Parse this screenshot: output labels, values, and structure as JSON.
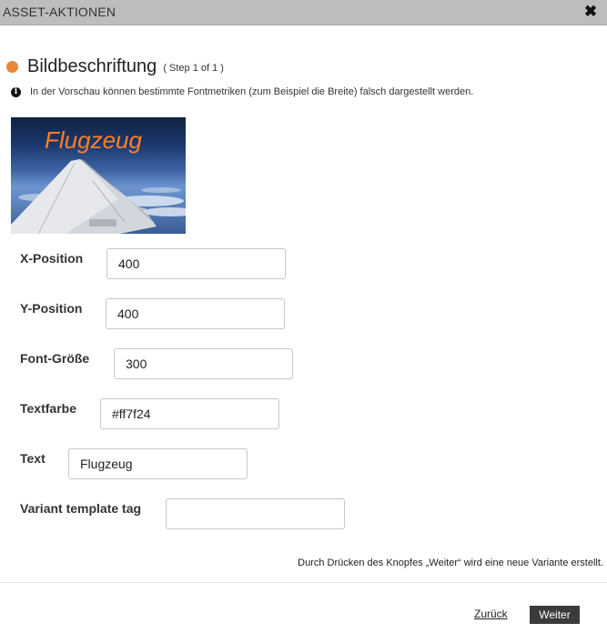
{
  "window": {
    "title": "ASSET-AKTIONEN",
    "close_icon": "close-icon"
  },
  "header": {
    "title": "Bildbeschriftung",
    "step": "( Step 1 of 1 )",
    "accent_color": "#e8873a"
  },
  "info": {
    "icon": "info-icon",
    "text": "In der Vorschau können bestimmte Fontmetriken (zum Beispiel die Breite) falsch dargestellt werden."
  },
  "preview": {
    "caption": "Flugzeug",
    "caption_color": "#ff7f24"
  },
  "fields": [
    {
      "label": "X-Position",
      "value": "400"
    },
    {
      "label": "Y-Position",
      "value": "400"
    },
    {
      "label": "Font-Größe",
      "value": "300"
    },
    {
      "label": "Textfarbe",
      "value": "#ff7f24"
    },
    {
      "label": "Text",
      "value": "Flugzeug"
    },
    {
      "label": "Variant template tag",
      "value": ""
    }
  ],
  "footer": {
    "note": "Durch Drücken des Knopfes „Weiter“ wird eine neue Variante erstellt.",
    "back_label": "Zurück",
    "next_label": "Weiter"
  }
}
